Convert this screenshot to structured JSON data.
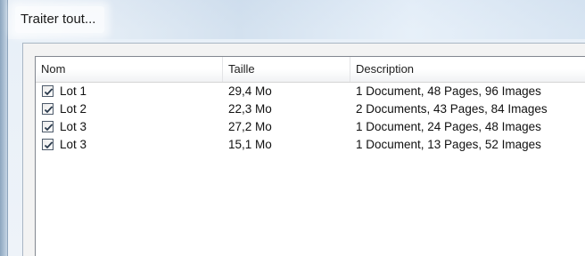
{
  "window": {
    "title": "Traiter tout..."
  },
  "list": {
    "columns": {
      "name": "Nom",
      "size": "Taille",
      "description": "Description"
    },
    "rows": [
      {
        "checked": true,
        "name": "Lot 1",
        "size": "29,4 Mo",
        "description": "1 Document, 48 Pages, 96 Images"
      },
      {
        "checked": true,
        "name": "Lot 2",
        "size": "22,3 Mo",
        "description": "2 Documents, 43 Pages, 84 Images"
      },
      {
        "checked": true,
        "name": "Lot 3",
        "size": "27,2 Mo",
        "description": "1 Document, 24 Pages, 48 Images"
      },
      {
        "checked": true,
        "name": "Lot 3",
        "size": "15,1 Mo",
        "description": "1 Document, 13 Pages, 52 Images"
      }
    ]
  },
  "icons": {
    "checkbox": "checkmark-icon"
  }
}
